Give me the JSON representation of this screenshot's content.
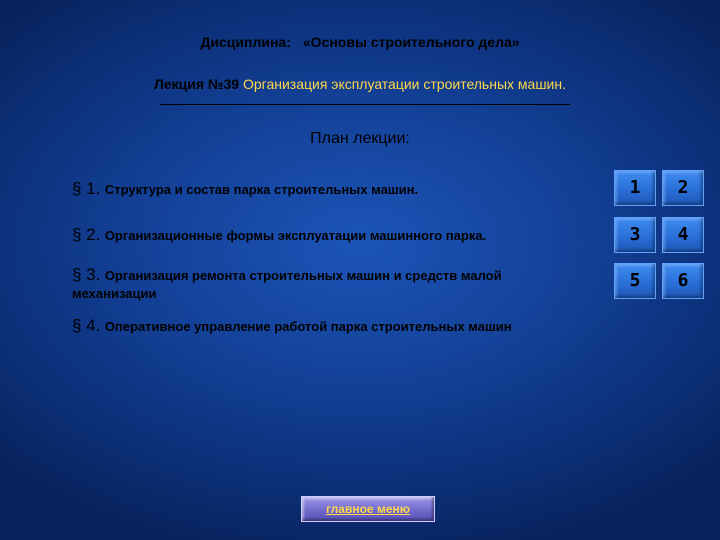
{
  "header": {
    "discipline_label": "Дисциплина:",
    "discipline_title": "«Основы строительного дела»",
    "lecture_label": "Лекция №39",
    "lecture_title": "Организация эксплуатации строительных машин."
  },
  "plan_title": "План лекции:",
  "sections": [
    {
      "num": "§ 1.",
      "text": "Структура и состав парка строительных машин."
    },
    {
      "num": "§ 2.",
      "text": "Организационные формы эксплуатации машинного парка."
    },
    {
      "num": "§ 3.",
      "text": "Организация ремонта строительных машин и средств малой",
      "text_cont": "механизации"
    },
    {
      "num": "§ 4.",
      "text": "Оперативное управление работой парка строительных машин"
    }
  ],
  "nav_buttons": [
    "1",
    "2",
    "3",
    "4",
    "5",
    "6"
  ],
  "main_menu_label": "главное меню",
  "colors": {
    "background": "#134096",
    "accent": "#ffd84a",
    "button": "#2a6fd8"
  }
}
